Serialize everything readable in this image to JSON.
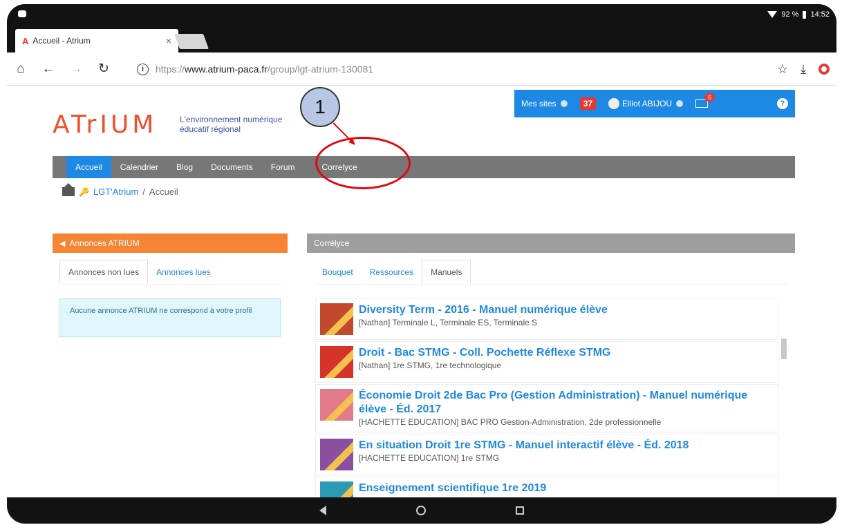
{
  "statusbar": {
    "battery": "92 %",
    "time": "14:52"
  },
  "browser": {
    "tab_title": "Accueil - Atrium",
    "tab_close": "×",
    "url_scheme": "https://",
    "url_host": "www.atrium-paca.fr",
    "url_path": "/group/lgt-atrium-130081"
  },
  "topbar": {
    "sites_label": "Mes sites",
    "notif_count": "37",
    "user_name": "Elliot ABIJOU",
    "mail_count": "6",
    "help": "?"
  },
  "brand": {
    "logo_text": "ATrIUM",
    "tagline_line1": "L'environnement numérique",
    "tagline_line2": "éducatif régional"
  },
  "nav": {
    "items": [
      {
        "label": "Accueil",
        "active": true
      },
      {
        "label": "Calendrier"
      },
      {
        "label": "Blog"
      },
      {
        "label": "Documents"
      },
      {
        "label": "Forum"
      },
      {
        "label": "Correlyce"
      }
    ]
  },
  "breadcrumb": {
    "group": "LGT'Atrium",
    "sep": "/",
    "page": "Accueil"
  },
  "annonces": {
    "header": "Annonces ATRIUM",
    "tab_unread": "Annonces non lues",
    "tab_read": "Annonces lues",
    "empty_message": "Aucune annonce ATRIUM ne correspond à votre profil"
  },
  "correlyce": {
    "header": "Corrélyce",
    "tabs": [
      "Bouquet",
      "Ressources",
      "Manuels"
    ],
    "books": [
      {
        "title": "Diversity Term - 2016 - Manuel numérique élève",
        "sub": "[Nathan] Terminale L, Terminale ES, Terminale S",
        "cover_color": "#c2492b"
      },
      {
        "title": "Droit - Bac STMG - Coll. Pochette Réflexe STMG",
        "sub": "[Nathan] 1re STMG, 1re technologique",
        "cover_color": "#d6332b"
      },
      {
        "title": "Économie Droit 2de Bac Pro (Gestion Administration) - Manuel numérique élève - Éd. 2017",
        "sub": "[HACHETTE EDUCATION] BAC PRO Gestion-Administration, 2de professionnelle",
        "cover_color": "#e27b8a"
      },
      {
        "title": "En situation Droit 1re STMG - Manuel interactif élève - Éd. 2018",
        "sub": "[HACHETTE EDUCATION] 1re STMG",
        "cover_color": "#8a4fa0"
      },
      {
        "title": "Enseignement scientifique 1re 2019",
        "sub": "",
        "cover_color": "#2a9bb3"
      }
    ]
  },
  "annotation": {
    "number": "1"
  },
  "colors": {
    "primary": "#1e88e5",
    "orange": "#f58534",
    "logo": "#ef4f2c",
    "annotation_red": "#e30613"
  }
}
